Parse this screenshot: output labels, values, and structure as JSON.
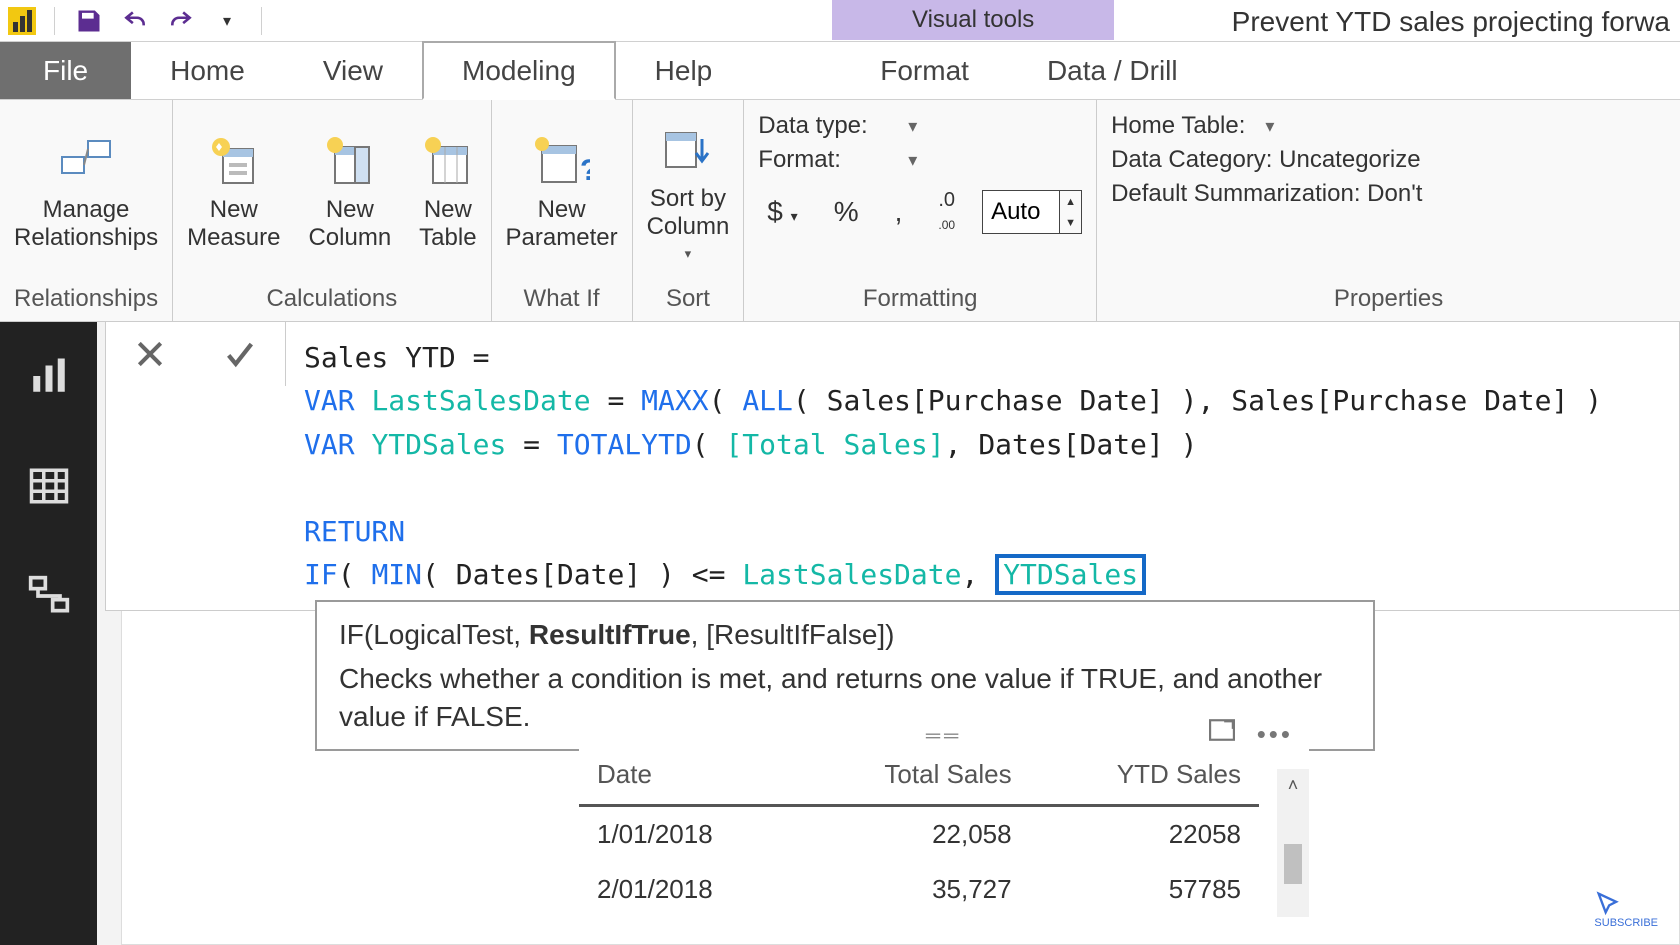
{
  "window": {
    "visual_tools_label": "Visual tools",
    "title": "Prevent YTD sales projecting forwa"
  },
  "qat": {
    "save": "Save",
    "undo": "Undo",
    "redo": "Redo",
    "customize": "Customize Quick Access Toolbar"
  },
  "tabs": {
    "file": "File",
    "home": "Home",
    "view": "View",
    "modeling": "Modeling",
    "help": "Help",
    "format": "Format",
    "data_drill": "Data / Drill",
    "active": "modeling"
  },
  "ribbon": {
    "relationships": {
      "manage": "Manage\nRelationships",
      "group": "Relationships"
    },
    "calculations": {
      "measure": "New\nMeasure",
      "column": "New\nColumn",
      "table": "New\nTable",
      "group": "Calculations"
    },
    "whatif": {
      "parameter": "New\nParameter",
      "group": "What If"
    },
    "sort": {
      "sortby": "Sort by\nColumn",
      "group": "Sort"
    },
    "formatting": {
      "data_type_label": "Data type:",
      "format_label": "Format:",
      "currency": "$",
      "percent": "%",
      "thousands": ",",
      "decimals_value": "Auto",
      "group": "Formatting"
    },
    "properties": {
      "home_table_label": "Home Table:",
      "data_category_label": "Data Category: Uncategorize",
      "default_summarization_label": "Default Summarization: Don't",
      "group": "Properties"
    }
  },
  "formula": {
    "line1_pre": "Sales YTD =",
    "var": "VAR",
    "LastSalesDate": "LastSalesDate",
    "eq": " = ",
    "MAXX": "MAXX",
    "ALL": "ALL",
    "sales_purchase": "Sales[Purchase Date]",
    "YTDSales_id": "YTDSales",
    "TOTALYTD": "TOTALYTD",
    "TotalSales": "[Total Sales]",
    "DatesDate": "Dates[Date]",
    "RETURN": "RETURN",
    "IF": "IF",
    "MIN": "MIN",
    "lte": " <= ",
    "comma": ","
  },
  "tooltip": {
    "sig_pre": "IF(LogicalTest, ",
    "sig_bold": "ResultIfTrue",
    "sig_post": ", [ResultIfFalse])",
    "desc": "Checks whether a condition is met, and returns one value if TRUE, and another value if FALSE."
  },
  "report": {
    "title_fragment": "Prev"
  },
  "table": {
    "headers": [
      "Date",
      "Total Sales",
      "YTD Sales"
    ],
    "rows": [
      {
        "date": "1/01/2018",
        "total": "22,058",
        "ytd": "22058"
      },
      {
        "date": "2/01/2018",
        "total": "35,727",
        "ytd": "57785"
      }
    ]
  },
  "subscribe": "SUBSCRIBE"
}
